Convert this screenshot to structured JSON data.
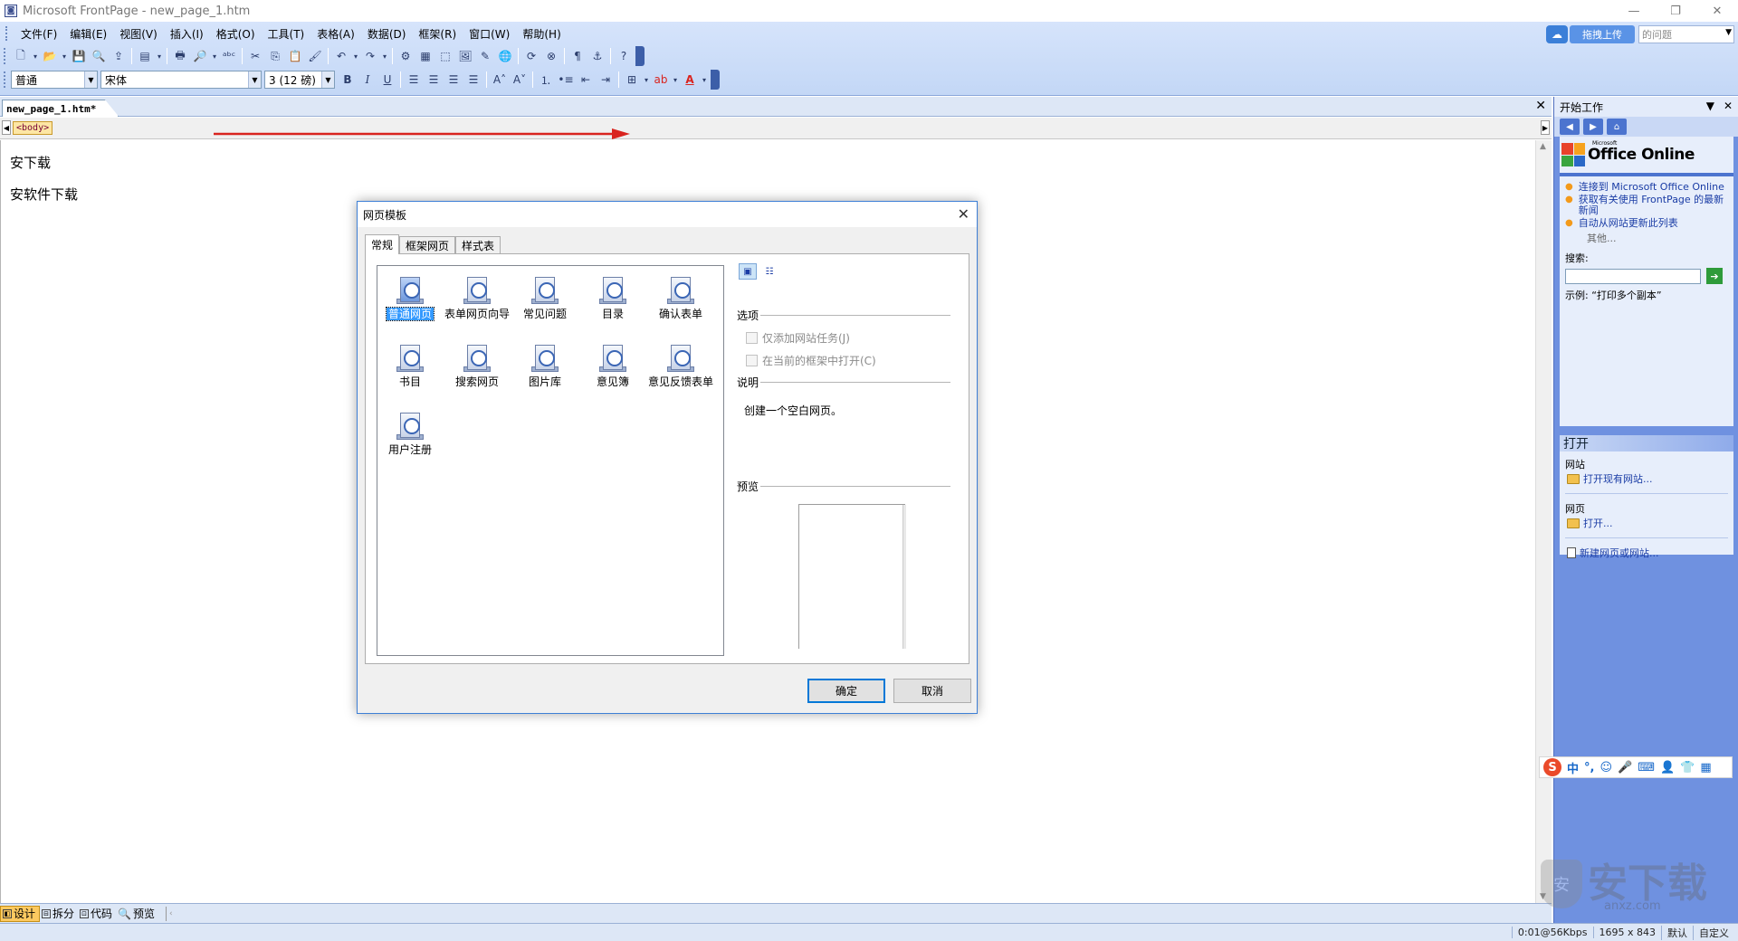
{
  "window": {
    "title": "Microsoft FrontPage - new_page_1.htm",
    "app_icon": "frontpage-icon"
  },
  "menubar": {
    "items": [
      "文件(F)",
      "编辑(E)",
      "视图(V)",
      "插入(I)",
      "格式(O)",
      "工具(T)",
      "表格(A)",
      "数据(D)",
      "框架(R)",
      "窗口(W)",
      "帮助(H)"
    ]
  },
  "upload_widget": {
    "button_label": "拖拽上传",
    "question_placeholder": "的问题"
  },
  "format_toolbar": {
    "style": "普通",
    "font": "宋体",
    "size": "3 (12 磅)",
    "bold": "B",
    "italic": "I",
    "underline": "U"
  },
  "document": {
    "tab_label": "new_page_1.htm*",
    "body_tag": "<body>",
    "paragraphs": [
      "安下载",
      "安软件下载"
    ]
  },
  "viewbar": {
    "design": "设计",
    "split": "拆分",
    "code": "代码",
    "preview": "预览"
  },
  "statusbar": {
    "speed": "0:01@56Kbps",
    "dimensions": "1695 x 843",
    "default": "默认",
    "custom": "自定义"
  },
  "taskpane": {
    "title": "开始工作",
    "office_online_label": "Office Online",
    "office_sup": "Microsoft",
    "links": [
      "连接到 Microsoft Office Online",
      "获取有关使用 FrontPage 的最新新闻",
      "自动从网站更新此列表"
    ],
    "more": "其他...",
    "search_label": "搜索:",
    "example_prefix": "示例:",
    "example_value": "“打印多个副本”",
    "open_header": "打开",
    "site_group": "网站",
    "open_site_link": "打开现有网站...",
    "page_group": "网页",
    "open_page_link": "打开...",
    "new_link": "新建网页或网站..."
  },
  "ime": {
    "items": [
      "中",
      "°,",
      "☺",
      "🎤",
      "⌨",
      "👤",
      "👕",
      "▦"
    ]
  },
  "watermark": {
    "text": "安下载",
    "sub": "anxz.com"
  },
  "dialog": {
    "title": "网页模板",
    "tabs": [
      "常规",
      "框架网页",
      "样式表"
    ],
    "templates": [
      "普通网页",
      "表单网页向导",
      "常见问题",
      "目录",
      "确认表单",
      "书目",
      "搜索网页",
      "图片库",
      "意见簿",
      "意见反馈表单",
      "用户注册"
    ],
    "options_label": "选项",
    "option_add_task": "仅添加网站任务(J)",
    "option_open_frame": "在当前的框架中打开(C)",
    "description_label": "说明",
    "description_text": "创建一个空白网页。",
    "preview_label": "预览",
    "ok": "确定",
    "cancel": "取消"
  },
  "colors": {
    "chrome": "#c3d7f6",
    "taskpane": "#6f91e0",
    "selection": "#3399ff",
    "accent_border": "#0078d7",
    "annotation_arrow": "#d9241f"
  }
}
